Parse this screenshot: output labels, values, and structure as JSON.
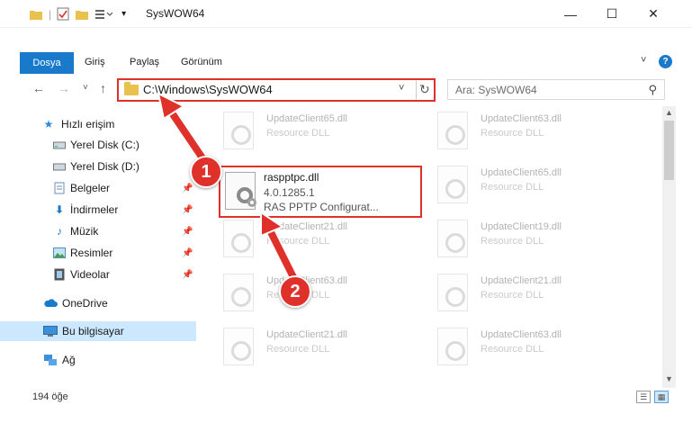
{
  "window": {
    "title": "SysWOW64",
    "minimize": "—",
    "maximize": "☐",
    "close": "✕"
  },
  "ribbon": {
    "file_tab": "Dosya",
    "tabs": [
      "Giriş",
      "Paylaş",
      "Görünüm"
    ],
    "help": "?"
  },
  "nav": {
    "back": "←",
    "forward": "→",
    "recent": "˅",
    "up": "↑",
    "path": "C:\\Windows\\SysWOW64",
    "search_placeholder": "Ara: SysWOW64"
  },
  "sidebar": {
    "items": [
      {
        "label": "Hızlı erişim",
        "icon": "star-icon"
      },
      {
        "label": "Yerel Disk (C:)",
        "icon": "drive-icon"
      },
      {
        "label": "Yerel Disk (D:)",
        "icon": "drive-icon"
      },
      {
        "label": "Belgeler",
        "icon": "documents-icon"
      },
      {
        "label": "İndirmeler",
        "icon": "download-icon"
      },
      {
        "label": "Müzik",
        "icon": "music-icon"
      },
      {
        "label": "Resimler",
        "icon": "pictures-icon"
      },
      {
        "label": "Videolar",
        "icon": "video-icon"
      },
      {
        "label": "OneDrive",
        "icon": "cloud-icon"
      },
      {
        "label": "Bu bilgisayar",
        "icon": "computer-icon"
      },
      {
        "label": "Ağ",
        "icon": "network-icon"
      }
    ]
  },
  "files": {
    "left_column": [
      {
        "name": "UpdateClient65.dll",
        "desc": "Resource DLL"
      },
      {
        "name": "UpdateClient21.dll",
        "desc": "Resource DLL"
      },
      {
        "name": "UpdateClient63.dll",
        "desc": "Resource DLL"
      },
      {
        "name": "UpdateClient21.dll",
        "desc": "Resource DLL"
      }
    ],
    "right_column": [
      {
        "name": "UpdateClient63.dll",
        "desc": "Resource DLL"
      },
      {
        "name": "UpdateClient65.dll",
        "desc": "Resource DLL"
      },
      {
        "name": "UpdateClient19.dll",
        "desc": "Resource DLL"
      },
      {
        "name": "UpdateClient21.dll",
        "desc": "Resource DLL"
      },
      {
        "name": "UpdateClient63.dll",
        "desc": "Resource DLL"
      }
    ],
    "highlighted": {
      "name": "raspptpc.dll",
      "version": "4.0.1285.1",
      "desc": "RAS PPTP Configurat..."
    }
  },
  "status": {
    "count": "194 öğe"
  },
  "annotations": {
    "step1": "1",
    "step2": "2"
  },
  "colors": {
    "accent": "#1979ca",
    "highlight_red": "#e0302a",
    "selection": "#cce8ff"
  }
}
